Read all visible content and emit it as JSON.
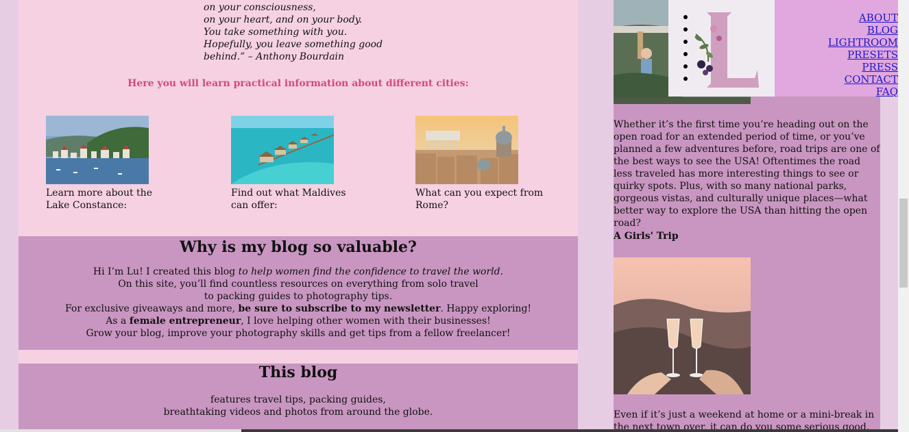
{
  "quote": {
    "lines": [
      "on your consciousness,",
      "on your heart, and on your body.",
      "You take something with you.",
      "Hopefully, you leave something good",
      "behind.” – Anthony Bourdain"
    ]
  },
  "learn_heading": "Here you will learn practical information about different cities:",
  "cities": [
    {
      "caption": "Learn more about the Lake Constance:"
    },
    {
      "caption": "Find out what Maldives can offer:"
    },
    {
      "caption": "What can you expect from Rome?"
    }
  ],
  "why": {
    "title": "Why is my blog so valuable?",
    "l1_a": "Hi I’m Lu! I created this blog ",
    "l1_b": "to help women find the confidence to travel the world",
    "l1_c": ".",
    "l2": "On this site, you’ll find countless resources on everything from solo travel",
    "l3": "to packing guides to photography tips.",
    "l4_a": "For exclusive giveaways and more, ",
    "l4_b": "be sure to subscribe to my newsletter",
    "l4_c": ". Happy exploring!",
    "l5_a": "As a ",
    "l5_b": "female entrepreneur",
    "l5_c": ", I love helping other women with their businesses!",
    "l6": "Grow your blog, improve your photography skills and get tips from a fellow freelancer!"
  },
  "this_blog": {
    "title": "This blog",
    "l1": "features travel tips, packing guides,",
    "l2": "breathtaking videos and photos from around the globe."
  },
  "nav": {
    "items": [
      "ABOUT",
      "BLOG",
      "LIGHTROOM PRESETS",
      "PRESS",
      "CONTACT",
      "FAQ"
    ]
  },
  "sidebar": {
    "intro": "Whether it’s the first time you’re heading out on the open road for an extended period of time, or you’ve planned a few adventures before, road trips are one of the best ways to see the USA! Oftentimes the road less traveled has more interesting things to see or quirky spots. Plus, with so many national parks, gorgeous vistas, and culturally unique places—what better way to explore the USA than hitting the open road?",
    "heading": "A Girls' Trip",
    "outro": "Even if it’s just a weekend at home or a mini-break in the next town over, it can do you some serious good. Here are a"
  },
  "colors": {
    "page_bg": "#e6cde3",
    "main_bg": "#f6d1e2",
    "panel_bg": "#c996c1",
    "nav_bg": "#e0a8de",
    "accent": "#d14a7b",
    "link": "#2218c8"
  }
}
